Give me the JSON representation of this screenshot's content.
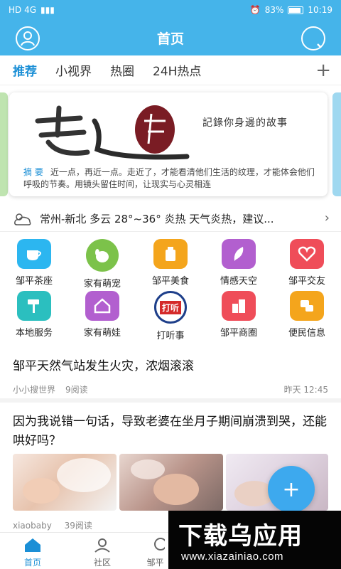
{
  "status_bar": {
    "carrier_icons": "HD 4G",
    "battery": "83%",
    "time": "10:19"
  },
  "header": {
    "title": "首页"
  },
  "tabs": [
    {
      "label": "推荐",
      "active": true
    },
    {
      "label": "小视界"
    },
    {
      "label": "热圈"
    },
    {
      "label": "24H热点"
    }
  ],
  "banner": {
    "slogan": "記錄你身邊的故事",
    "tag": "摘 要",
    "description": "近一点，再近一点。走近了，才能看清他们生活的纹理，才能体会他们呼吸的节奏。用镜头留住时间，让现实与心灵相连"
  },
  "weather": {
    "text": "常州-新北 多云 28°~36° 炎热 天气炎热，建议..."
  },
  "grid": [
    {
      "label": "邹平茶座",
      "icon": "tea-cup-icon",
      "color": "#2cb6f0"
    },
    {
      "label": "家有萌宠",
      "icon": "dog-icon",
      "color": "#7cc24a"
    },
    {
      "label": "邹平美食",
      "icon": "food-icon",
      "color": "#f4a51c"
    },
    {
      "label": "情感天空",
      "icon": "feather-icon",
      "color": "#b25fcf"
    },
    {
      "label": "邹平交友",
      "icon": "heart-icon",
      "color": "#ef4d59"
    },
    {
      "label": "本地服务",
      "icon": "brush-icon",
      "color": "#2bbfbf"
    },
    {
      "label": "家有萌娃",
      "icon": "house-icon",
      "color": "#b25fcf"
    },
    {
      "label": "打听事",
      "icon": "inquire-icon",
      "color": "#d42a2a"
    },
    {
      "label": "邹平商圈",
      "icon": "buildings-icon",
      "color": "#ef4d59"
    },
    {
      "label": "便民信息",
      "icon": "info-icon",
      "color": "#f4a51c"
    }
  ],
  "grid_inquire_text": "打听",
  "articles": [
    {
      "title": "邹平天然气站发生火灾，浓烟滚滚",
      "author": "小小搜世界",
      "reads": "9阅读",
      "time": "昨天 12:45"
    },
    {
      "title": "因为我说错一句话，导致老婆在坐月子期间崩溃到哭，还能哄好吗？",
      "author": "xiaobaby",
      "reads": "39阅读"
    }
  ],
  "fab": {
    "label": "+"
  },
  "bottom_nav": [
    {
      "label": "首页",
      "icon": "home-icon",
      "active": true
    },
    {
      "label": "社区",
      "icon": "community-icon"
    },
    {
      "label": "邹平",
      "icon": "partial-icon"
    }
  ],
  "watermark": {
    "big": "下载乌应用",
    "url": "www.xiazainiao.com"
  }
}
